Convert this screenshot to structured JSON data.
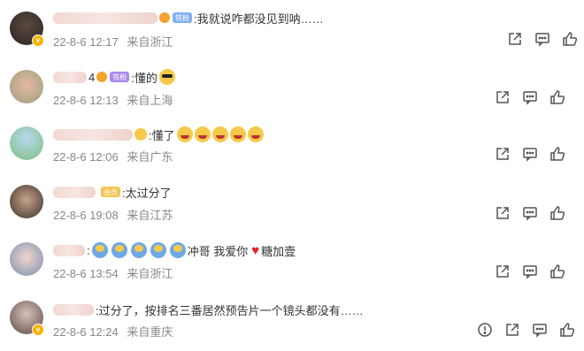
{
  "comments": [
    {
      "text": ":我就说咋都没见到呐……",
      "badge": "铁粉",
      "date": "22-8-6 12:17",
      "location": "来自浙江",
      "verified": true
    },
    {
      "prefix": "4",
      "badge": "铁粉",
      "text": ":懂的",
      "date": "22-8-6 12:13",
      "location": "来自上海",
      "verified": false
    },
    {
      "text": ":懂了",
      "date": "22-8-6 12:06",
      "location": "来自广东",
      "verified": false
    },
    {
      "badge": "会员",
      "text": ":太过分了",
      "date": "22-8-6 19:08",
      "location": "来自江苏",
      "verified": false
    },
    {
      "text_prefix": ":",
      "text_mid": "冲哥 我爱你",
      "text_end": "糖加壹",
      "date": "22-8-6 13:54",
      "location": "来自浙江",
      "verified": false
    },
    {
      "text": ":过分了，按排名三番居然预告片一个镜头都没有……",
      "date": "22-8-6 12:24",
      "location": "来自重庆",
      "verified": true
    }
  ],
  "icons": {
    "share": "share-icon",
    "comment": "comment-icon",
    "like": "thumbs-up-icon",
    "report": "report-icon",
    "verified": "verified-badge-icon"
  },
  "colors": {
    "meta": "#888888",
    "badge_gold": "#f5b400",
    "heart": "#e0242e"
  }
}
